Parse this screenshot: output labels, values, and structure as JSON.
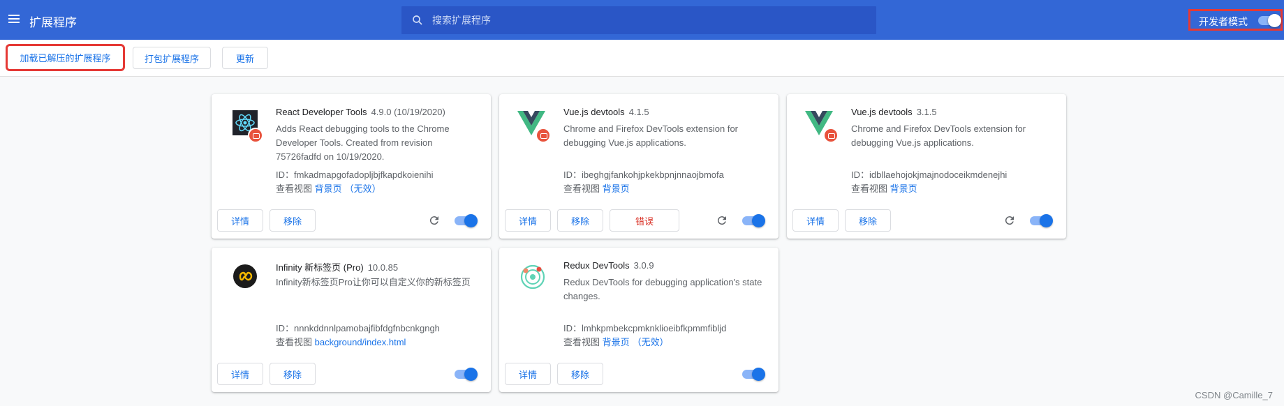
{
  "header": {
    "title": "扩展程序",
    "search_placeholder": "搜索扩展程序",
    "devmode_label": "开发者模式",
    "devmode_on": true
  },
  "toolbar": {
    "load_unpacked": "加载已解压的扩展程序",
    "pack": "打包扩展程序",
    "update": "更新"
  },
  "labels": {
    "id_prefix": "ID：",
    "inspect_views": "查看视图",
    "details": "详情",
    "remove": "移除",
    "errors": "错误"
  },
  "extensions": [
    {
      "name": "React Developer Tools",
      "version": "4.9.0 (10/19/2020)",
      "description": "Adds React debugging tools to the Chrome Developer Tools. Created from revision 75726fadfd on 10/19/2020.",
      "id": "fmkadmapgofadopljbjfkapdkoienihi",
      "view_link": "背景页",
      "view_status": "（无效）",
      "enabled": true,
      "icon": "react-icon"
    },
    {
      "name": "Vue.js devtools",
      "version": "4.1.5",
      "description": "Chrome and Firefox DevTools extension for debugging Vue.js applications.",
      "id": "ibeghgjfankohjpkekbpnjnnaojbmofa",
      "view_link": "背景页",
      "view_status": "",
      "enabled": true,
      "icon": "vue-icon"
    },
    {
      "name": "Vue.js devtools",
      "version": "3.1.5",
      "description": "Chrome and Firefox DevTools extension for debugging Vue.js applications.",
      "id": "idbllaehojokjmajnodoceikmdenejhi",
      "view_link": "背景页",
      "view_status": "",
      "enabled": true,
      "icon": "vue-icon"
    },
    {
      "name": "Infinity 新标签页 (Pro)",
      "version": "10.0.85",
      "description": "Infinity新标签页Pro让你可以自定义你的新标签页",
      "id": "nnnkddnnlpamobajfibfdgfnbcnkgngh",
      "view_link": "background/index.html",
      "view_status": "",
      "enabled": true,
      "icon": "infinity-icon"
    },
    {
      "name": "Redux DevTools",
      "version": "3.0.9",
      "description": "Redux DevTools for debugging application's state changes.",
      "id": "lmhkpmbekcpmknklioeibfkpmmfibljd",
      "view_link": "背景页",
      "view_status": "（无效）",
      "enabled": true,
      "icon": "redux-icon"
    }
  ],
  "watermark": "CSDN @Camille_7",
  "colors": {
    "header": "#3367d6",
    "accent": "#1a73e8",
    "error": "#d93025",
    "highlight": "#e53935"
  }
}
